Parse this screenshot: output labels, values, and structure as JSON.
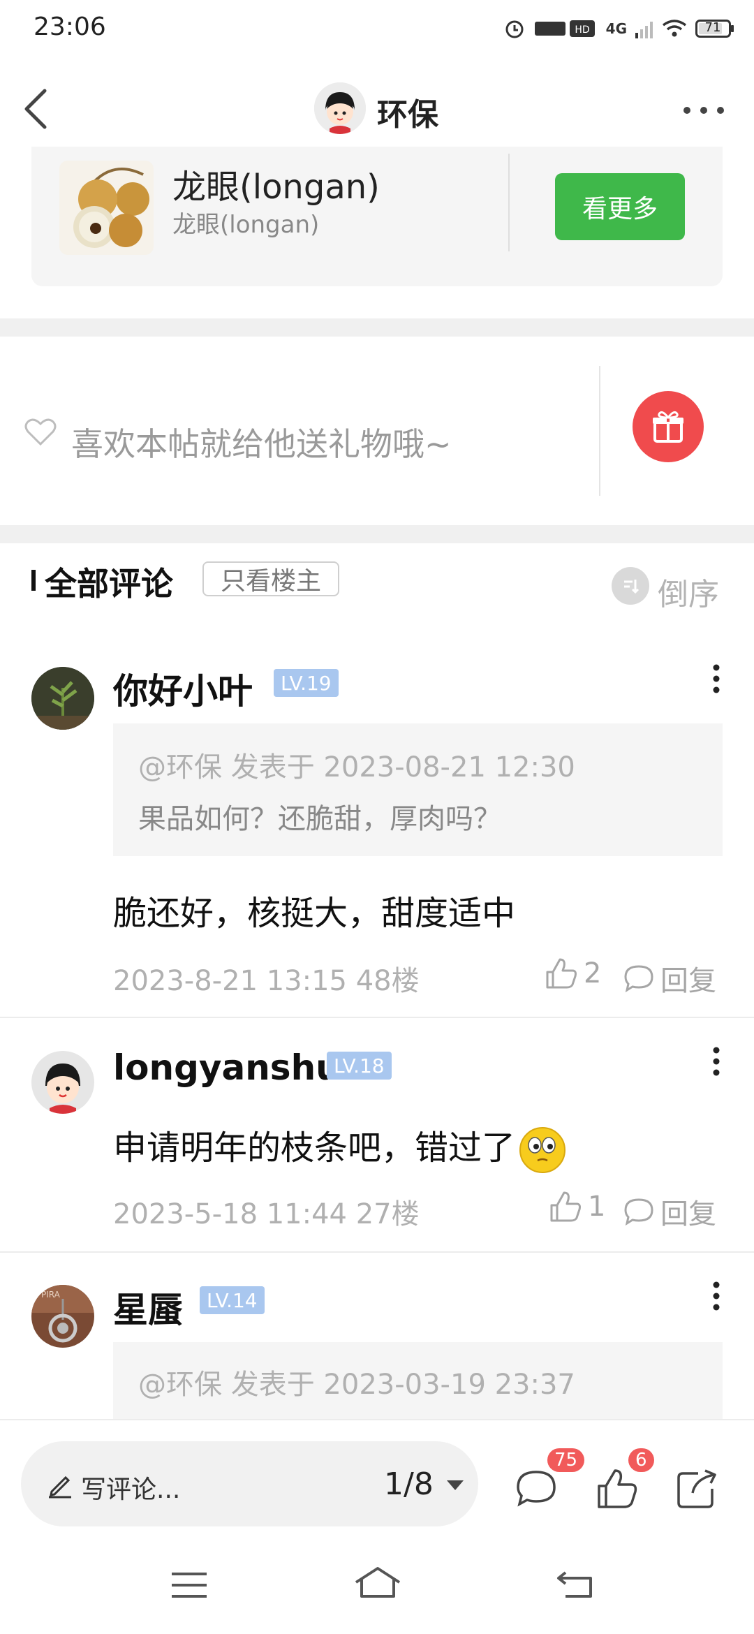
{
  "status_bar": {
    "time": "23:06",
    "battery": "71",
    "network": "4G",
    "icons": [
      "alarm-icon",
      "signal-hd-icon",
      "wifi-icon",
      "battery-icon"
    ]
  },
  "header": {
    "title": "环保",
    "back_icon": "chevron-left-icon",
    "more_icon": "more-horizontal-icon"
  },
  "product_card": {
    "name": "龙眼(longan)",
    "subtitle": "龙眼(longan)",
    "button_label": "看更多",
    "button_color": "#3fb84a"
  },
  "gift_bar": {
    "prompt": "喜欢本帖就给他送礼物哦~",
    "gift_color": "#f04b4d"
  },
  "comments_section": {
    "title": "全部评论",
    "filter_label": "只看楼主",
    "sort_label": "倒序"
  },
  "comments": [
    {
      "username": "你好小叶",
      "level": "LV.19",
      "quote_meta": "@环保 发表于 2023-08-21 12:30",
      "quote_text": "果品如何？还脆甜，厚肉吗？",
      "text": "脆还好，核挺大，甜度适中",
      "meta": "2023-8-21 13:15  48楼",
      "likes": "2",
      "reply_label": "回复"
    },
    {
      "username": "longyanshu",
      "level": "LV.18",
      "text": "申请明年的枝条吧，错过了",
      "meta": "2023-5-18 11:44  27楼",
      "likes": "1",
      "reply_label": "回复"
    },
    {
      "username": "星蜃",
      "level": "LV.14",
      "quote_meta": "@环保 发表于 2023-03-19 23:37"
    }
  ],
  "bottom_bar": {
    "write_placeholder": "写评论...",
    "page_indicator": "1/8",
    "comment_count": "75",
    "like_count": "6"
  },
  "system_nav": [
    "menu-icon",
    "home-icon",
    "back-icon"
  ]
}
